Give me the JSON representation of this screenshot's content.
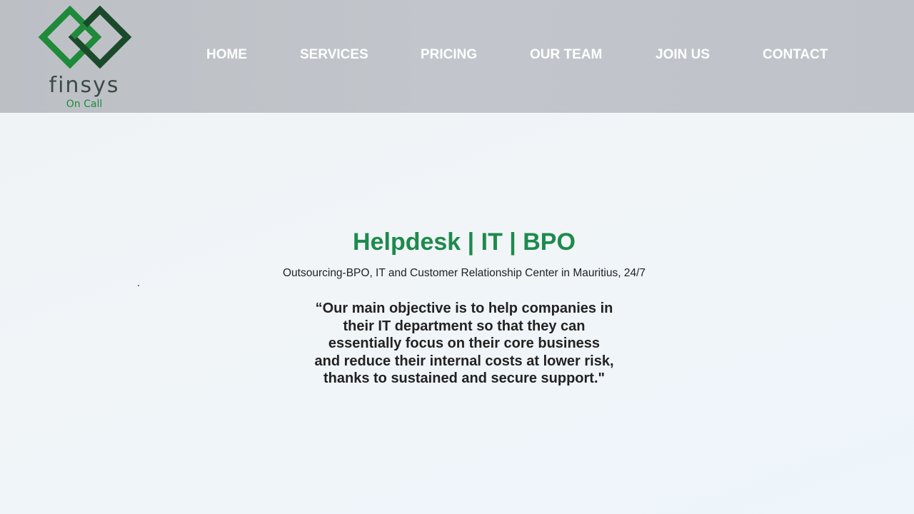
{
  "brand": {
    "name": "finsys",
    "tagline": "On Call",
    "icon": "interlocked-diamonds-logo",
    "colors": {
      "green": "#1e8a3a",
      "dark_green": "#1b4a2b"
    }
  },
  "nav": {
    "items": [
      {
        "label": "HOME"
      },
      {
        "label": "SERVICES"
      },
      {
        "label": "PRICING"
      },
      {
        "label": "OUR TEAM"
      },
      {
        "label": "JOIN US"
      },
      {
        "label": "CONTACT"
      }
    ]
  },
  "hero": {
    "title": "Helpdesk | IT | BPO",
    "subtitle": "Outsourcing-BPO, IT and Customer Relationship Center in Mauritius, 24/7",
    "quote_lines": [
      "“Our main objective is to help companies in",
      "their IT department so that they can",
      "essentially focus on their core business",
      "and reduce their internal costs at lower risk,",
      "thanks to sustained and secure support.\""
    ]
  },
  "theme": {
    "header_bg": "#c0c4ca",
    "title_color": "#1e8a4c",
    "nav_text": "#ffffff"
  }
}
